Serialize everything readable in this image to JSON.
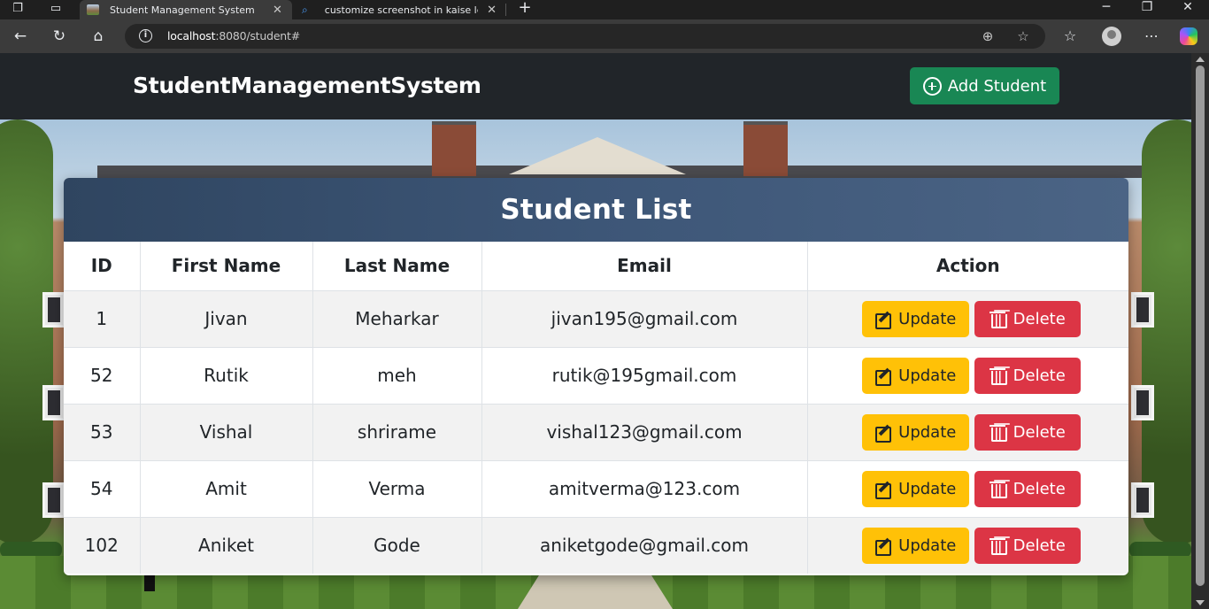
{
  "browser": {
    "tabs": [
      {
        "title": "Student Management System",
        "active": true
      },
      {
        "title": "customize screenshot in kaise le lap",
        "active": false
      }
    ],
    "url_host": "localhost",
    "url_rest": ":8080/student#"
  },
  "navbar": {
    "brand": "StudentManagementSystem",
    "add_button_label": "Add Student"
  },
  "card": {
    "title": "Student List"
  },
  "table": {
    "headers": [
      "ID",
      "First Name",
      "Last Name",
      "Email",
      "Action"
    ],
    "rows": [
      {
        "id": "1",
        "first_name": "Jivan",
        "last_name": "Meharkar",
        "email": "jivan195@gmail.com"
      },
      {
        "id": "52",
        "first_name": "Rutik",
        "last_name": "meh",
        "email": "rutik@195gmail.com"
      },
      {
        "id": "53",
        "first_name": "Vishal",
        "last_name": "shrirame",
        "email": "vishal123@gmail.com"
      },
      {
        "id": "54",
        "first_name": "Amit",
        "last_name": "Verma",
        "email": "amitverma@123.com"
      },
      {
        "id": "102",
        "first_name": "Aniket",
        "last_name": "Gode",
        "email": "aniketgode@gmail.com"
      }
    ],
    "update_label": "Update",
    "delete_label": "Delete"
  },
  "colors": {
    "navbar": "#212529",
    "add_button": "#198754",
    "card_header": "#3d5677",
    "update_button": "#ffc107",
    "delete_button": "#dc3545"
  }
}
